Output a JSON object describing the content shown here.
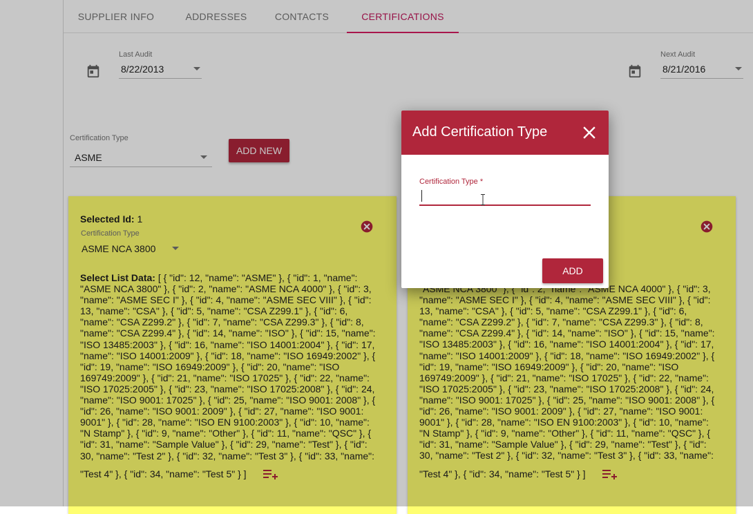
{
  "tabs": [
    {
      "label": "SUPPLIER INFO",
      "active": false
    },
    {
      "label": "ADDRESSES",
      "active": false
    },
    {
      "label": "CONTACTS",
      "active": false
    },
    {
      "label": "CERTIFICATIONS",
      "active": true
    }
  ],
  "last_audit": {
    "label": "Last Audit",
    "value": "8/22/2013",
    "icon": "calendar-icon"
  },
  "next_audit": {
    "label": "Next Audit",
    "value": "8/21/2016",
    "icon": "calendar-icon"
  },
  "cert_type_select": {
    "label": "Certification Type",
    "value": "ASME"
  },
  "add_new_label": "ADD NEW",
  "card_left": {
    "selected_label": "Selected Id:",
    "selected_value": "1",
    "cert_label": "Certification Type",
    "cert_value": "ASME NCA 3800",
    "list_label": "Select List Data:",
    "list_lines": [
      "[ { \"id\": 12, \"name\": \"ASME\" }, { \"id\": 1, \"name\":",
      "\"ASME NCA 3800\" }, { \"id\": 2, \"name\": \"ASME NCA 4000\" }, { \"id\": 3,",
      "\"name\": \"ASME SEC I\" }, { \"id\": 4, \"name\": \"ASME SEC VIII\" }, { \"id\":",
      "13, \"name\": \"CSA\" }, { \"id\": 5, \"name\": \"CSA Z299.1\" }, { \"id\": 6,",
      "\"name\": \"CSA Z299.2\" }, { \"id\": 7, \"name\": \"CSA Z299.3\" }, { \"id\": 8,",
      "\"name\": \"CSA Z299.4\" }, { \"id\": 14, \"name\": \"ISO\" }, { \"id\": 15, \"name\":",
      "\"ISO 13485:2003\" }, { \"id\": 16, \"name\": \"ISO 14001:2004\" }, { \"id\": 17,",
      "\"name\": \"ISO 14001:2009\" }, { \"id\": 18, \"name\": \"ISO 16949:2002\" }, {",
      "\"id\": 19, \"name\": \"ISO 16949:2009\" }, { \"id\": 20, \"name\": \"ISO",
      "169749:2009\" }, { \"id\": 21, \"name\": \"ISO 17025\" }, { \"id\": 22, \"name\":",
      "\"ISO 17025:2005\" }, { \"id\": 23, \"name\": \"ISO 17025:2008\" }, { \"id\": 24,",
      "\"name\": \"ISO 9001: 17025\" }, { \"id\": 25, \"name\": \"ISO 9001: 2008\" }, {",
      "\"id\": 26, \"name\": \"ISO 9001: 2009\" }, { \"id\": 27, \"name\": \"ISO 9001:",
      "9001\" }, { \"id\": 28, \"name\": \"ISO EN 9100:2003\" }, { \"id\": 10, \"name\":",
      "\"N Stamp\" }, { \"id\": 9, \"name\": \"Other\" }, { \"id\": 11, \"name\": \"QSC\" }, {",
      "\"id\": 31, \"name\": \"Sample Value\" }, { \"id\": 29, \"name\": \"Test\" }, { \"id\":",
      "30, \"name\": \"Test 2\" }, { \"id\": 32, \"name\": \"Test 3\" }, { \"id\": 33, \"name\":"
    ],
    "last_line": "\"Test 4\" }, { \"id\": 34, \"name\": \"Test 5\" } ]"
  },
  "card_right": {
    "list_lines": [
      "\"ASME NCA 3800\" }, { \"id\": 2, \"name\": \"ASME NCA 4000\" }, { \"id\": 3,",
      "\"name\": \"ASME SEC I\" }, { \"id\": 4, \"name\": \"ASME SEC VIII\" }, { \"id\":",
      "13, \"name\": \"CSA\" }, { \"id\": 5, \"name\": \"CSA Z299.1\" }, { \"id\": 6,",
      "\"name\": \"CSA Z299.2\" }, { \"id\": 7, \"name\": \"CSA Z299.3\" }, { \"id\": 8,",
      "\"name\": \"CSA Z299.4\" }, { \"id\": 14, \"name\": \"ISO\" }, { \"id\": 15, \"name\":",
      "\"ISO 13485:2003\" }, { \"id\": 16, \"name\": \"ISO 14001:2004\" }, { \"id\": 17,",
      "\"name\": \"ISO 14001:2009\" }, { \"id\": 18, \"name\": \"ISO 16949:2002\" }, {",
      "\"id\": 19, \"name\": \"ISO 16949:2009\" }, { \"id\": 20, \"name\": \"ISO",
      "169749:2009\" }, { \"id\": 21, \"name\": \"ISO 17025\" }, { \"id\": 22, \"name\":",
      "\"ISO 17025:2005\" }, { \"id\": 23, \"name\": \"ISO 17025:2008\" }, { \"id\": 24,",
      "\"name\": \"ISO 9001: 17025\" }, { \"id\": 25, \"name\": \"ISO 9001: 2008\" }, {",
      "\"id\": 26, \"name\": \"ISO 9001: 2009\" }, { \"id\": 27, \"name\": \"ISO 9001:",
      "9001\" }, { \"id\": 28, \"name\": \"ISO EN 9100:2003\" }, { \"id\": 10, \"name\":",
      "\"N Stamp\" }, { \"id\": 9, \"name\": \"Other\" }, { \"id\": 11, \"name\": \"QSC\" }, {",
      "\"id\": 31, \"name\": \"Sample Value\" }, { \"id\": 29, \"name\": \"Test\" }, { \"id\":",
      "30, \"name\": \"Test 2\" }, { \"id\": 32, \"name\": \"Test 3\" }, { \"id\": 33, \"name\":"
    ],
    "last_line": "\"Test 4\" }, { \"id\": 34, \"name\": \"Test 5\" } ]"
  },
  "dialog": {
    "title": "Add Certification Type",
    "field_label": "Certification Type *",
    "field_value": "",
    "add_label": "ADD"
  },
  "colors": {
    "accent": "#b0263b",
    "tab_active": "#c2185b",
    "card_bg": "#ffff70"
  }
}
